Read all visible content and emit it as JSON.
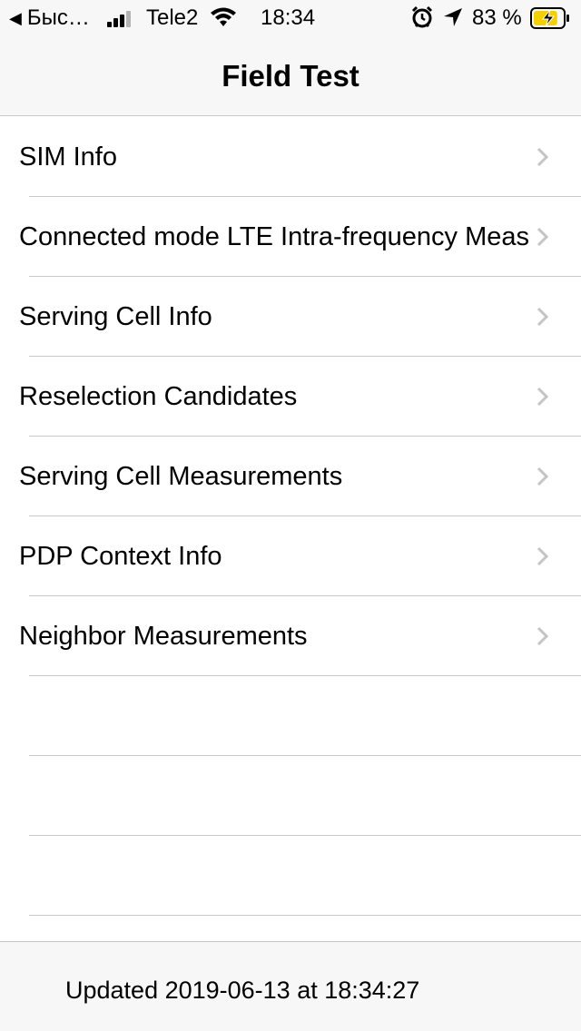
{
  "status_bar": {
    "back_label": "Быс…",
    "carrier": "Tele2",
    "time": "18:34",
    "battery_percent": "83 %",
    "battery_level": 0.83,
    "battery_color": "#f5d000",
    "icons": [
      "back-arrow-icon",
      "signal-icon",
      "wifi-icon",
      "alarm-icon",
      "location-arrow-icon",
      "battery-charging-icon"
    ]
  },
  "nav": {
    "title": "Field Test"
  },
  "list": {
    "items": [
      {
        "label": "SIM Info"
      },
      {
        "label": "Connected mode LTE Intra-frequency Meas"
      },
      {
        "label": "Serving Cell Info"
      },
      {
        "label": "Reselection Candidates"
      },
      {
        "label": "Serving Cell Measurements"
      },
      {
        "label": "PDP Context Info"
      },
      {
        "label": "Neighbor Measurements"
      }
    ],
    "chevron_icon": "chevron-right-icon",
    "chevron_color": "#c4c4c7",
    "separator_color": "#c8c7cc"
  },
  "footer": {
    "updated_text": "Updated 2019-06-13 at 18:34:27"
  }
}
